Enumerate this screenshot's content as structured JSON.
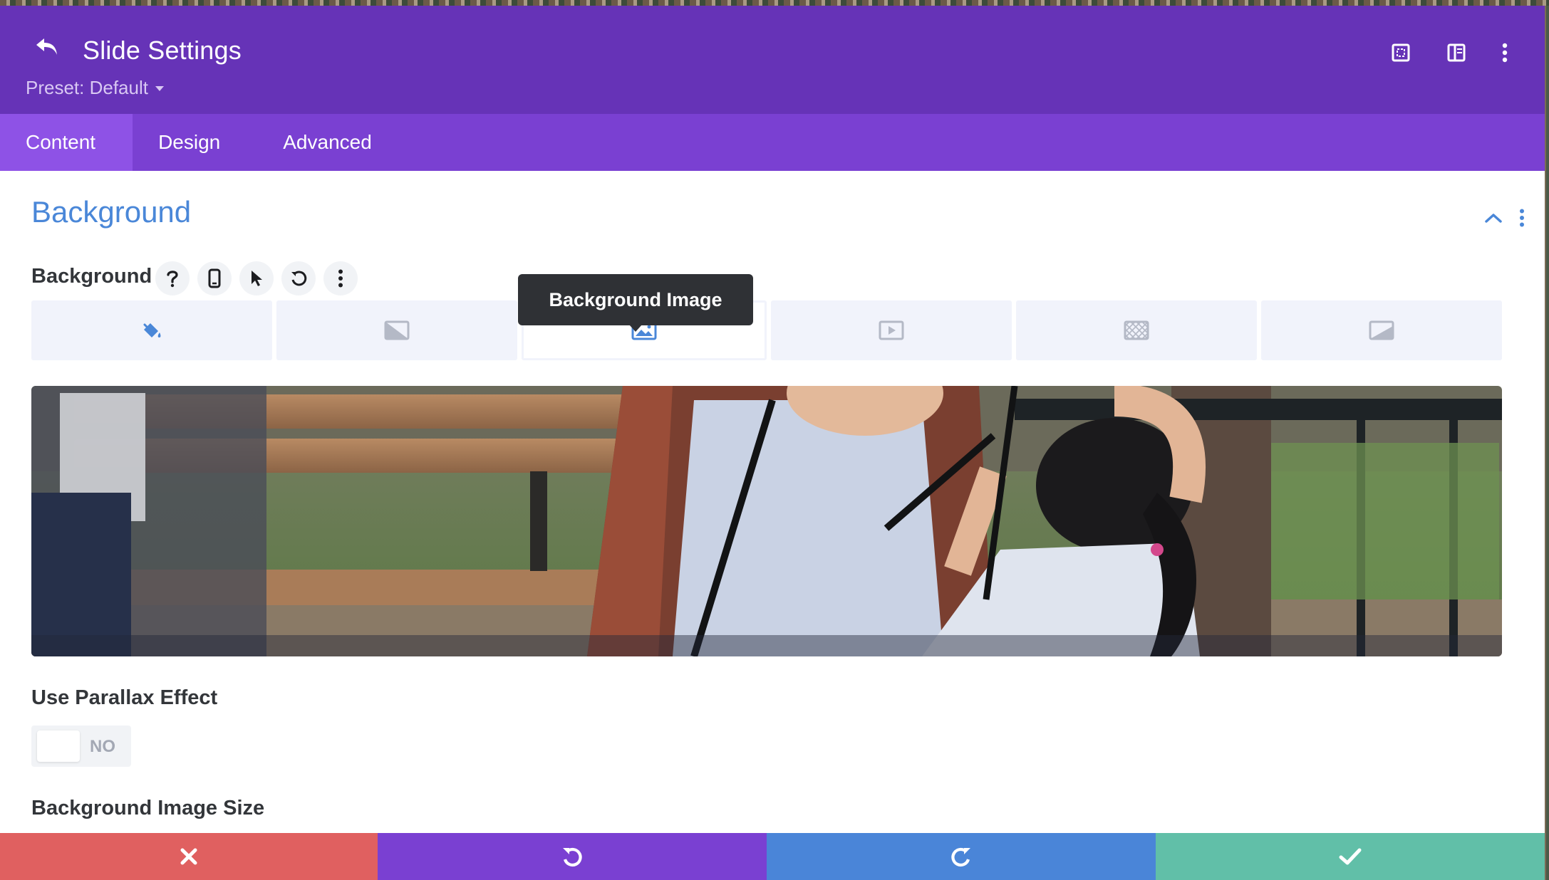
{
  "header": {
    "title": "Slide Settings",
    "preset": "Preset: Default",
    "color": "#6633b7"
  },
  "tabs": [
    {
      "label": "Content",
      "active": true
    },
    {
      "label": "Design",
      "active": false
    },
    {
      "label": "Advanced",
      "active": false
    }
  ],
  "section": {
    "title": "Background",
    "field_label": "Background"
  },
  "bg_types": [
    "background-color",
    "background-gradient",
    "background-image",
    "background-video",
    "background-pattern",
    "background-mask"
  ],
  "active_bg_type": "background-image",
  "tooltip": "Background Image",
  "parallax": {
    "label": "Use Parallax Effect",
    "state": "NO"
  },
  "image_size_label": "Background Image Size",
  "footer": {
    "colors": {
      "cancel": "#e06060",
      "undo": "#7a40d2",
      "redo": "#4a85d8",
      "save": "#61bfa8"
    }
  }
}
